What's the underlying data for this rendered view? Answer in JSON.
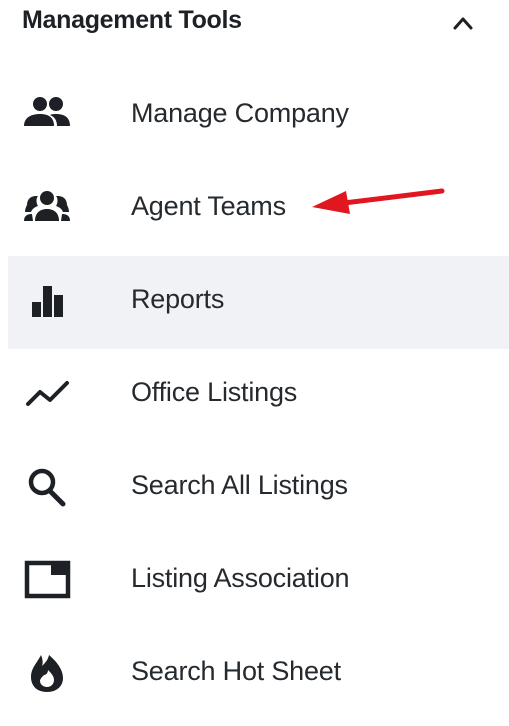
{
  "section": {
    "title": "Management Tools",
    "expanded": true,
    "toggle_icon": "chevron-up-icon"
  },
  "items": [
    {
      "label": "Manage Company",
      "icon": "people-icon",
      "active": false
    },
    {
      "label": "Agent Teams",
      "icon": "team-icon",
      "active": false
    },
    {
      "label": "Reports",
      "icon": "bar-chart-icon",
      "active": true
    },
    {
      "label": "Office Listings",
      "icon": "trend-line-icon",
      "active": false
    },
    {
      "label": "Search All Listings",
      "icon": "search-icon",
      "active": false
    },
    {
      "label": "Listing Association",
      "icon": "window-icon",
      "active": false
    },
    {
      "label": "Search Hot Sheet",
      "icon": "flame-icon",
      "active": false
    }
  ],
  "annotation": {
    "icon": "red-arrow-icon",
    "color": "#e0171f"
  },
  "colors": {
    "text": "#1f2327",
    "active_background": "#f0f2f5"
  }
}
